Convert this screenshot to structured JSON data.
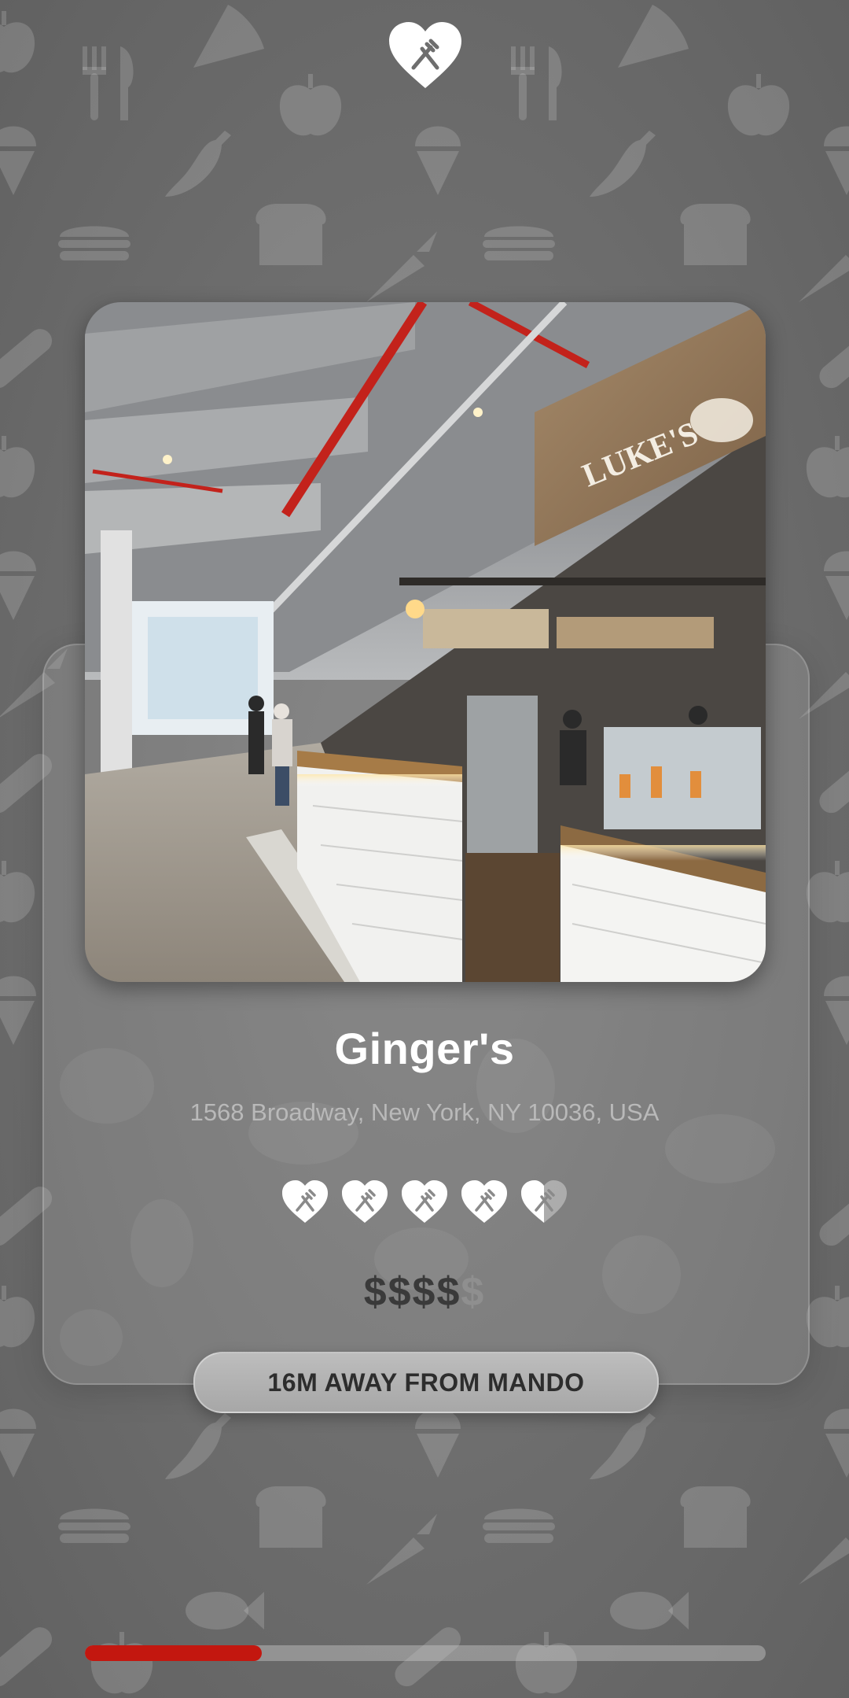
{
  "restaurant": {
    "name": "Ginger's",
    "address": "1568 Broadway, New York, NY 10036, USA"
  },
  "rating": {
    "value": 4.5,
    "max": 5,
    "icon": "heart-fork-knife-icon"
  },
  "price": {
    "level": 4,
    "max": 5,
    "symbol": "$"
  },
  "distance": {
    "label": "16M AWAY FROM MANDO"
  },
  "progress": {
    "fraction": 0.26
  },
  "photo": {
    "sign_text": "LUKE'S"
  },
  "colors": {
    "accent": "#c3170f",
    "background": "#6f6f6f",
    "name_text": "#ffffff",
    "address_text": "#b9b9b9",
    "price_active": "#3a3a3a",
    "price_inactive": "#8f8f8f"
  }
}
